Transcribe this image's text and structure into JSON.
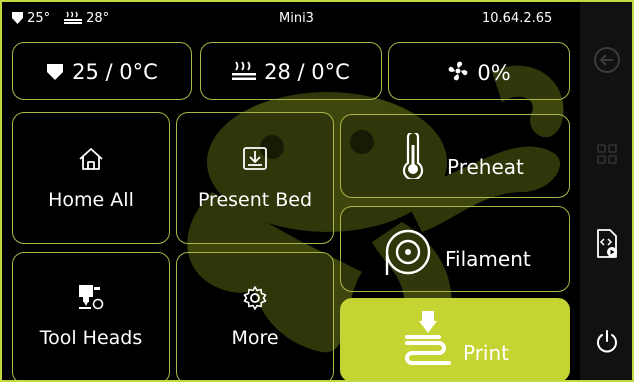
{
  "status_bar": {
    "hotend_temp": "25°",
    "bed_temp": "28°",
    "printer_name": "Mini3",
    "ip_address": "10.64.2.65"
  },
  "temps": {
    "hotend": "25 / 0°C",
    "bed": "28 / 0°C",
    "fan": "0%"
  },
  "tiles": {
    "home_all": "Home All",
    "present_bed": "Present Bed",
    "tool_heads": "Tool Heads",
    "more": "More",
    "preheat": "Preheat",
    "filament": "Filament",
    "print": "Print"
  },
  "sidebar": {
    "icons": [
      "back-arrow-icon",
      "grid-menu-icon",
      "file-play-icon",
      "power-icon"
    ]
  },
  "colors": {
    "accent": "#c3d433",
    "border": "#a9b746",
    "background": "#000000",
    "sidebar_icon_dim": "#3a3a3a"
  }
}
